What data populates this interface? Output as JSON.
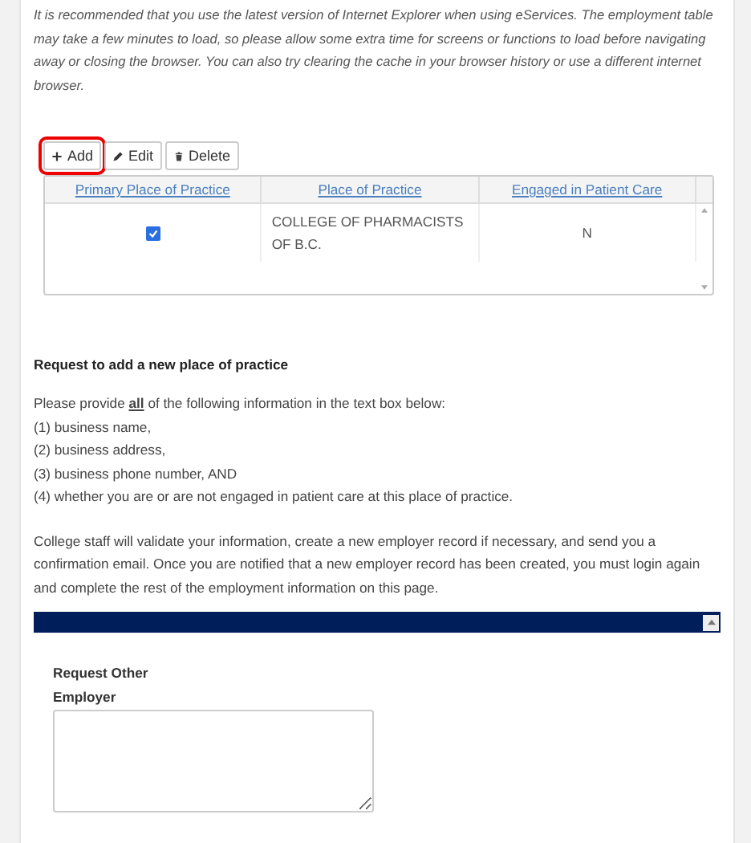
{
  "notice": "It is recommended that you use the latest version of Internet Explorer when using eServices.  The employment table may take a few minutes to load, so please allow some extra time for screens or functions to load before navigating away or closing the browser.  You can also try clearing the cache in your browser history or use a different internet browser.",
  "toolbar": [
    {
      "kind": "add",
      "label": "Add",
      "highlighted": true
    },
    {
      "kind": "edit",
      "label": "Edit",
      "highlighted": false
    },
    {
      "kind": "delete",
      "label": "Delete",
      "highlighted": false
    }
  ],
  "table": {
    "columns": [
      "Primary Place of Practice",
      "Place of Practice",
      "Engaged in Patient Care"
    ],
    "rows": [
      {
        "primary": true,
        "place": "COLLEGE OF PHARMACISTS OF B.C.",
        "engaged": "N"
      }
    ]
  },
  "request": {
    "heading": "Request to add a new place of practice",
    "intro": "Please provide **all** of the following information in the text box below:",
    "items": [
      "(1) business name,",
      "(2) business address,",
      "(3) business phone number, AND",
      "(4) whether you are or are not engaged in patient care at this place of practice."
    ],
    "note": "College staff will validate your information, create a new employer record if necessary, and send you a confirmation email.  Once you are notified that a new employer record has been created, you must login again and complete the rest of the employment information on this page."
  },
  "form": {
    "label": "Request Other Employer"
  }
}
